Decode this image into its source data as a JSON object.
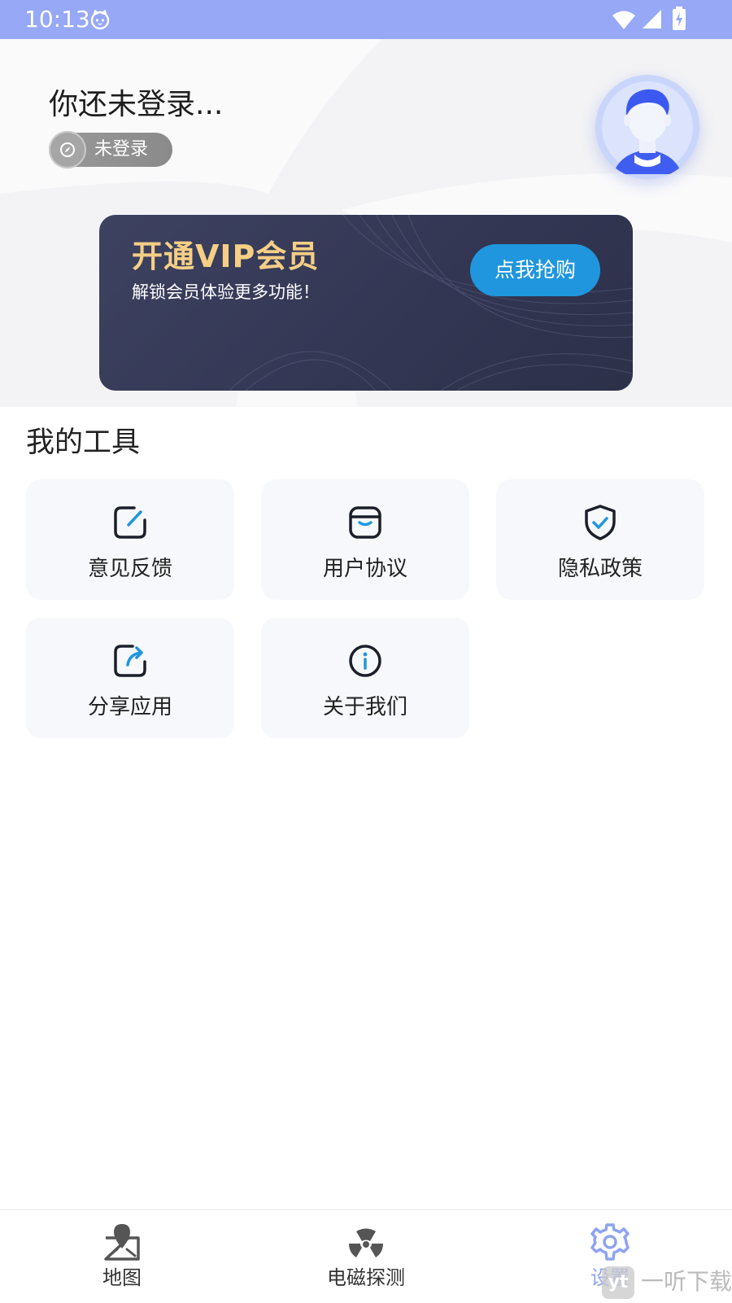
{
  "status_bar": {
    "time": "10:13",
    "bg_color": "#96a8f6"
  },
  "header": {
    "greeting": "你还未登录...",
    "login_status": "未登录",
    "avatar_icon": "user-avatar"
  },
  "vip_banner": {
    "title": "开通VIP会员",
    "subtitle": "解锁会员体验更多功能！",
    "button_label": "点我抢购",
    "title_color": "#f6cf85",
    "button_color": "#1f96dd"
  },
  "tools": {
    "section_title": "我的工具",
    "items": [
      {
        "label": "意见反馈",
        "icon": "edit-icon"
      },
      {
        "label": "用户协议",
        "icon": "document-icon"
      },
      {
        "label": "隐私政策",
        "icon": "shield-check-icon"
      },
      {
        "label": "分享应用",
        "icon": "share-icon"
      },
      {
        "label": "关于我们",
        "icon": "info-icon"
      }
    ]
  },
  "bottom_nav": {
    "items": [
      {
        "label": "地图",
        "icon": "map-icon",
        "active": false
      },
      {
        "label": "电磁探测",
        "icon": "radiation-icon",
        "active": false
      },
      {
        "label": "设置",
        "icon": "settings-gear-icon",
        "active": true
      }
    ],
    "active_color": "#8fa3f2"
  },
  "watermark": {
    "logo_text": "yt",
    "text": "一听下载"
  }
}
